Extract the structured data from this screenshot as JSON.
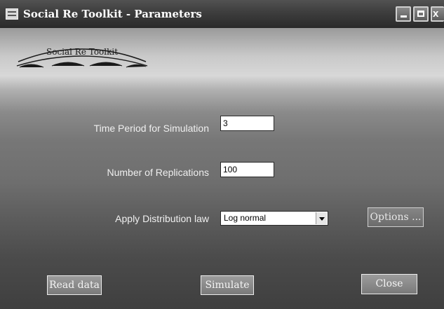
{
  "window": {
    "title": "Social Re Toolkit - Parameters",
    "close_glyph": "x"
  },
  "logo": {
    "text": "Social Re Toolkit"
  },
  "form": {
    "time_period": {
      "label": "Time Period for Simulation",
      "value": "3"
    },
    "replications": {
      "label": "Number of Replications",
      "value": "100"
    },
    "distribution": {
      "label": "Apply Distribution law",
      "selected": "Log normal"
    },
    "options_label": "Options ..."
  },
  "footer": {
    "read_data_label": "Read data",
    "simulate_label": "Simulate",
    "close_label": "Close"
  },
  "icons": {
    "app": "app-window-icon",
    "minimize": "minimize-icon",
    "maximize": "maximize-icon",
    "close": "close-icon",
    "dropdown": "chevron-down-icon"
  }
}
